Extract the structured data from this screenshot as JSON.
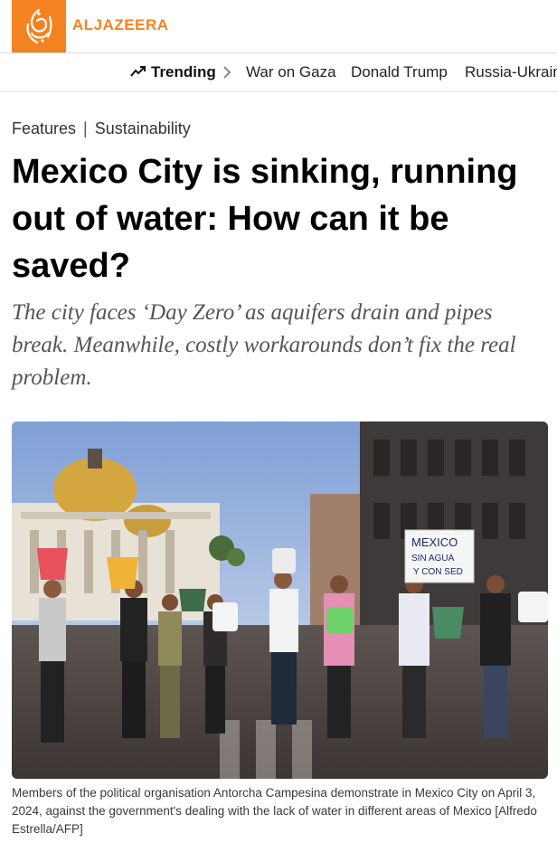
{
  "header": {
    "brand": "ALJAZEERA",
    "logo_icon": "aljazeera-calligraphy-logo",
    "brand_color": "#f58220"
  },
  "trending": {
    "label": "Trending",
    "icon": "trending-up-icon",
    "links": [
      "War on Gaza",
      "Donald Trump",
      "Russia-Ukrain"
    ]
  },
  "article": {
    "breadcrumb": [
      "Features",
      "Sustainability"
    ],
    "breadcrumb_separator": "|",
    "title": "Mexico City is sinking, running out of water: How can it be saved?",
    "subtitle": "The city faces ‘Day Zero’ as aquifers drain and pipes break. Meanwhile, costly workarounds don’t fix the real problem.",
    "image": {
      "sign_text": [
        "MEXICO",
        "SIN AGUA",
        "Y CON SED"
      ]
    },
    "caption": "Members of the political organisation Antorcha Campesina demonstrate in Mexico City on April 3, 2024, against the government's dealing with the lack of water in different areas of Mexico [Alfredo Estrella/AFP]"
  }
}
